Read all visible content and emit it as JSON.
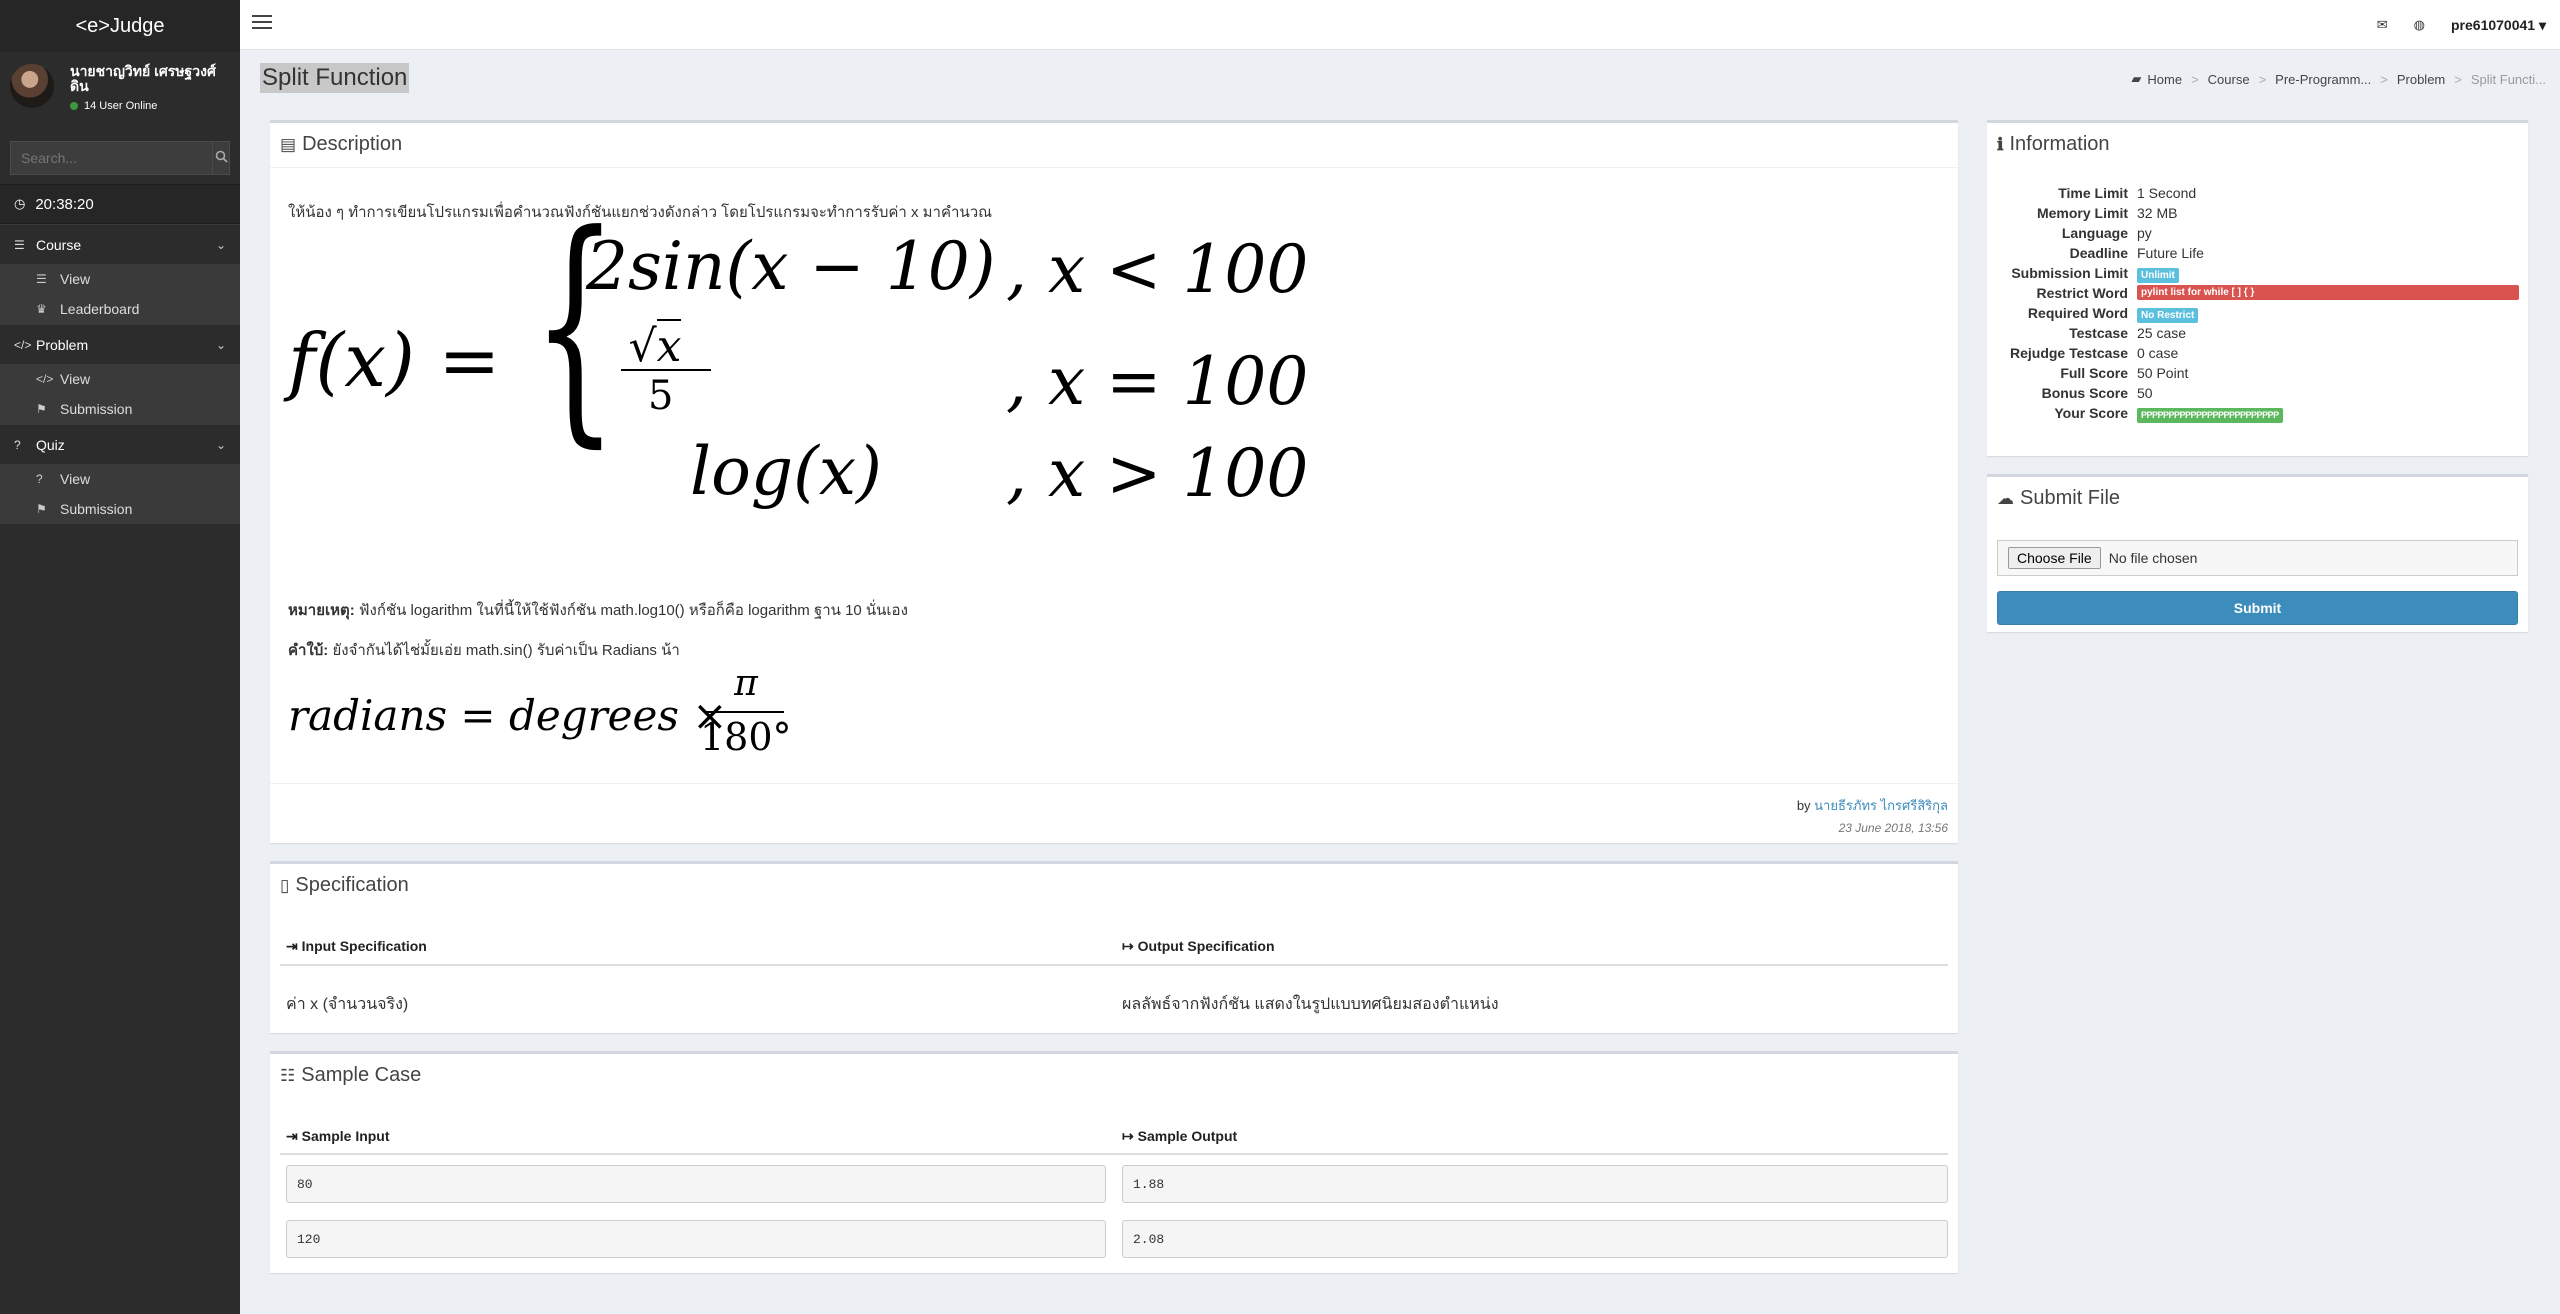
{
  "app": {
    "logo": "<e>Judge"
  },
  "user": {
    "name": "นายชาญวิทย์ เศรษฐวงศ์ ดิน",
    "online": "14 User Online"
  },
  "search": {
    "placeholder": "Search..."
  },
  "clock": "20:38:20",
  "menu": {
    "course": {
      "label": "Course",
      "items": [
        "View",
        "Leaderboard"
      ]
    },
    "problem": {
      "label": "Problem",
      "items": [
        "View",
        "Submission"
      ]
    },
    "quiz": {
      "label": "Quiz",
      "items": [
        "View",
        "Submission"
      ]
    }
  },
  "topbar": {
    "username": "pre61070041"
  },
  "page": {
    "title": "Split Function"
  },
  "breadcrumb": [
    "Home",
    "Course",
    "Pre-Programm...",
    "Problem",
    "Split Functi..."
  ],
  "description": {
    "title": "Description",
    "intro": "ให้น้อง ๆ ทำการเขียนโปรแกรมเพื่อคำนวณฟังก์ชันแยกช่วงดังกล่าว โดยโปรแกรมจะทำการรับค่า x มาคำนวณ",
    "note_label": "หมายเหตุ:",
    "note_text": " ฟังก์ชัน logarithm ในที่นี้ให้ใช้ฟังก์ชัน math.log10() หรือก็คือ logarithm ฐาน 10 นั่นเอง",
    "hint_label": "คำใบ้:",
    "hint_text": " ยังจำกันได้ไช่มั้ยเอ่ย math.sin() รับค่าเป็น Radians น้า",
    "author_prefix": "by ",
    "author": "นายธีรภัทร ไกรศรีสิริกุล",
    "date": "23 June 2018, 13:56"
  },
  "specification": {
    "title": "Specification",
    "input_head": "Input Specification",
    "output_head": "Output Specification",
    "input_text": "ค่า x (จำนวนจริง)",
    "output_text": "ผลลัพธ์จากฟังก์ชัน แสดงในรูปแบบทศนิยมสองตำแหน่ง"
  },
  "samples": {
    "title": "Sample Case",
    "input_head": "Sample Input",
    "output_head": "Sample Output",
    "rows": [
      {
        "input": "80",
        "output": "1.88"
      },
      {
        "input": "120",
        "output": "2.08"
      }
    ]
  },
  "information": {
    "title": "Information",
    "rows": [
      {
        "k": "Time Limit",
        "v": "1 Second"
      },
      {
        "k": "Memory Limit",
        "v": "32 MB"
      },
      {
        "k": "Language",
        "v": "py"
      },
      {
        "k": "Deadline",
        "v": "Future Life"
      },
      {
        "k": "Submission Limit",
        "v": "Unlimit"
      },
      {
        "k": "Restrict Word",
        "v": "pylint list for while [ ] { }"
      },
      {
        "k": "Required Word",
        "v": "No Restrict"
      },
      {
        "k": "Testcase",
        "v": "25 case"
      },
      {
        "k": "Rejudge Testcase",
        "v": "0 case"
      },
      {
        "k": "Full Score",
        "v": "50 Point"
      },
      {
        "k": "Bonus Score",
        "v": "50"
      },
      {
        "k": "Your Score",
        "v": "PPPPPPPPPPPPPPPPPPPPPPPPP"
      }
    ],
    "colors": {
      "unlimit": "#5bc0de",
      "restrict": "#d9534f",
      "required": "#5bc0de",
      "score": "#5cb85c"
    }
  },
  "submit": {
    "title": "Submit File",
    "choose": "Choose File",
    "no_file": "No file chosen",
    "button": "Submit"
  }
}
